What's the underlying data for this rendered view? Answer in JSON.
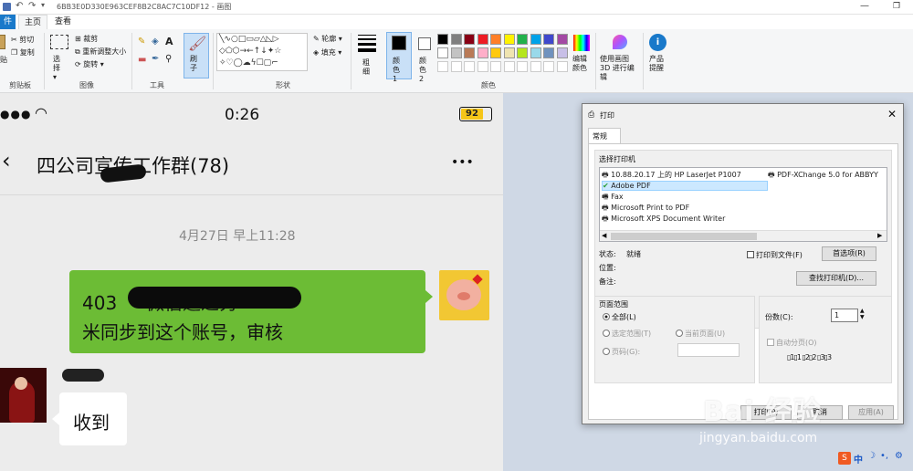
{
  "window": {
    "title": "6BB3E0D330E963CEF8B2C8AC7C10DF12 - 画图"
  },
  "tabs": {
    "file": "件",
    "home": "主页",
    "view": "查看"
  },
  "ribbon": {
    "clipboard": {
      "cut": "剪切",
      "copy": "复制",
      "paste_partial": "贴",
      "label": "剪贴板"
    },
    "image": {
      "select": "选择",
      "crop": "裁剪",
      "resize": "重新调整大小",
      "rotate": "旋转",
      "label": "图像"
    },
    "tools": {
      "label": "工具"
    },
    "brushes": {
      "label": "刷子"
    },
    "shapes": {
      "outline": "轮廓",
      "fill": "填充",
      "label": "形状"
    },
    "size": {
      "label": "粗细"
    },
    "color1": {
      "label": "颜色1"
    },
    "color2": {
      "label": "颜色2"
    },
    "colors": {
      "label": "颜色",
      "edit": "编辑颜色"
    },
    "paint3d": "使用画图 3D 进行编辑",
    "product": "产品提醒",
    "palette": [
      "#000000",
      "#7f7f7f",
      "#880015",
      "#ed1c24",
      "#ff7f27",
      "#fff200",
      "#22b14c",
      "#00a2e8",
      "#3f48cc",
      "#a349a4",
      "#ffffff",
      "#c3c3c3",
      "#b97a57",
      "#ffaec9",
      "#ffc90e",
      "#efe4b0",
      "#b5e61d",
      "#99d9ea",
      "#7092be",
      "#c8bfe7"
    ]
  },
  "phone": {
    "time": "0:26",
    "battery": "92",
    "chat_title": "四公司宣传工作群(78)",
    "more": "•••",
    "timestamp": "4月27日 早上11:28",
    "bubble_sent_line1": "403     微信通过秀",
    "bubble_sent_line2": "米同步到这个账号，审核",
    "bubble_recv": "收到"
  },
  "dialog": {
    "title": "打印",
    "tab": "常规",
    "select_printer": "选择打印机",
    "printers": [
      "10.88.20.17 上的 HP LaserJet P1007",
      "Adobe PDF",
      "Fax",
      "Microsoft Print to PDF",
      "Microsoft XPS Document Writer",
      "PDF-XChange 5.0 for ABBYY"
    ],
    "status_label": "状态:",
    "status_value": "就绪",
    "location_label": "位置:",
    "comment_label": "备注:",
    "print_to_file": "打印到文件(F)",
    "preferences": "首选项(R)",
    "find_printer": "查找打印机(D)...",
    "page_range": "页面范围",
    "all": "全部(L)",
    "selection": "选定范围(T)",
    "current_page": "当前页面(U)",
    "pages": "页码(G):",
    "copies_label": "份数(C):",
    "copies_value": "1",
    "collate": "自动分页(O)",
    "print_btn": "打印(P)",
    "cancel_btn": "取消",
    "apply_btn": "应用(A)"
  },
  "watermark": {
    "logo": "Bai 经验",
    "url": "jingyan.baidu.com"
  },
  "tray": {
    "ime": "中"
  }
}
